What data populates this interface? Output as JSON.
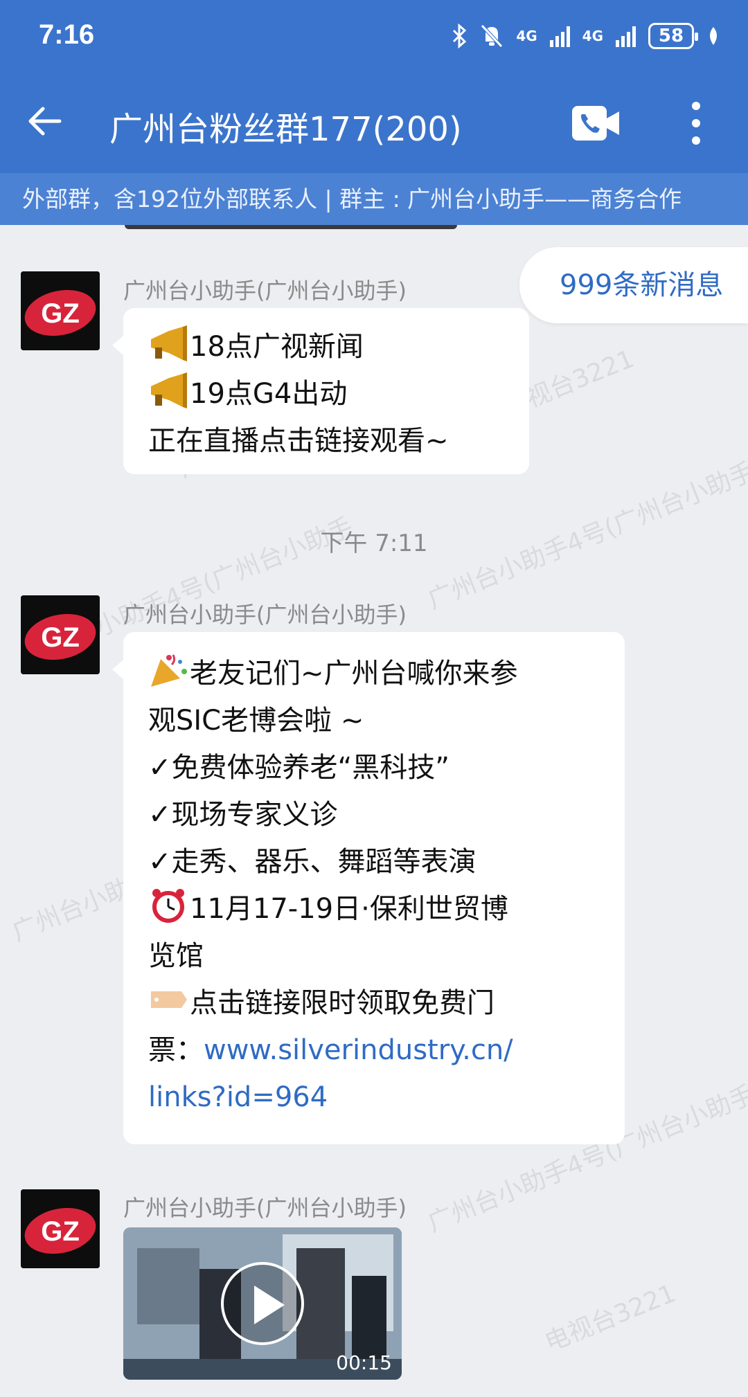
{
  "status": {
    "time": "7:16",
    "network1": "4G",
    "network2": "4G",
    "battery": "58"
  },
  "header": {
    "title": "广州台粉丝群177(200)",
    "subtitle": "外部群，含192位外部联系人 | 群主 : 广州台小助手——商务合作"
  },
  "new_messages": "999条新消息",
  "watermark_text": "广州台小助手4号(广州台小助手",
  "watermark_text2": "电视台3221",
  "avatar_text": "GZ",
  "messages": [
    {
      "sender": "广州台小助手(广州台小助手)",
      "lines": [
        "18点广视新闻",
        "19点G4出动",
        "正在直播点击链接观看~"
      ]
    },
    {
      "sender": "广州台小助手(广州台小助手)",
      "lines": [
        "老友记们~广州台喊你来参",
        "观SIC老博会啦 ~",
        "✓免费体验养老“黑科技”",
        "✓现场专家义诊",
        "✓走秀、器乐、舞蹈等表演",
        "11月17-19日·保利世贸博",
        "览馆",
        "点击链接限时领取免费门",
        "票："
      ],
      "link_part1": "www.silverindustry.cn/",
      "link_part2": "links?id=964"
    },
    {
      "sender": "广州台小助手(广州台小助手)",
      "video_duration": "00:15"
    }
  ],
  "timestamp": "下午 7:11",
  "colors": {
    "header_bg": "#3b74cc",
    "link": "#2f6bc4",
    "chat_bg": "#eceef1"
  }
}
